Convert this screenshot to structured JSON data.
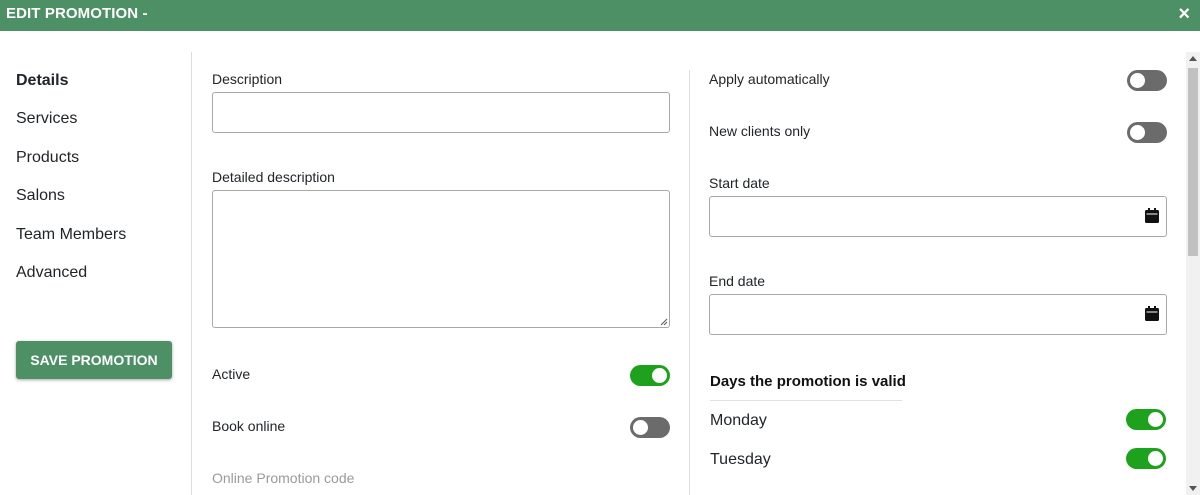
{
  "dialog": {
    "title": "EDIT PROMOTION -",
    "close_label": "×"
  },
  "sidebar": {
    "items": [
      {
        "label": "Details",
        "active": true
      },
      {
        "label": "Services",
        "active": false
      },
      {
        "label": "Products",
        "active": false
      },
      {
        "label": "Salons",
        "active": false
      },
      {
        "label": "Team Members",
        "active": false
      },
      {
        "label": "Advanced",
        "active": false
      }
    ],
    "save_label": "SAVE PROMOTION"
  },
  "left_column": {
    "description_label": "Description",
    "description_value": "",
    "detailed_description_label": "Detailed description",
    "detailed_description_value": "",
    "active_label": "Active",
    "active_on": true,
    "book_online_label": "Book online",
    "book_online_on": false,
    "online_code_label": "Online Promotion code"
  },
  "right_column": {
    "apply_auto_label": "Apply automatically",
    "apply_auto_on": false,
    "new_clients_label": "New clients only",
    "new_clients_on": false,
    "start_date_label": "Start date",
    "start_date_value": "",
    "end_date_label": "End date",
    "end_date_value": "",
    "days_title": "Days the promotion is valid",
    "days": [
      {
        "label": "Monday",
        "on": true
      },
      {
        "label": "Tuesday",
        "on": true
      }
    ]
  },
  "colors": {
    "brand_green": "#4e9065",
    "toggle_on": "#1ea21e",
    "toggle_off": "#6b6b6b"
  },
  "icons": {
    "close": "close-icon",
    "calendar": "calendar-icon",
    "resize": "resize-grip-icon"
  }
}
